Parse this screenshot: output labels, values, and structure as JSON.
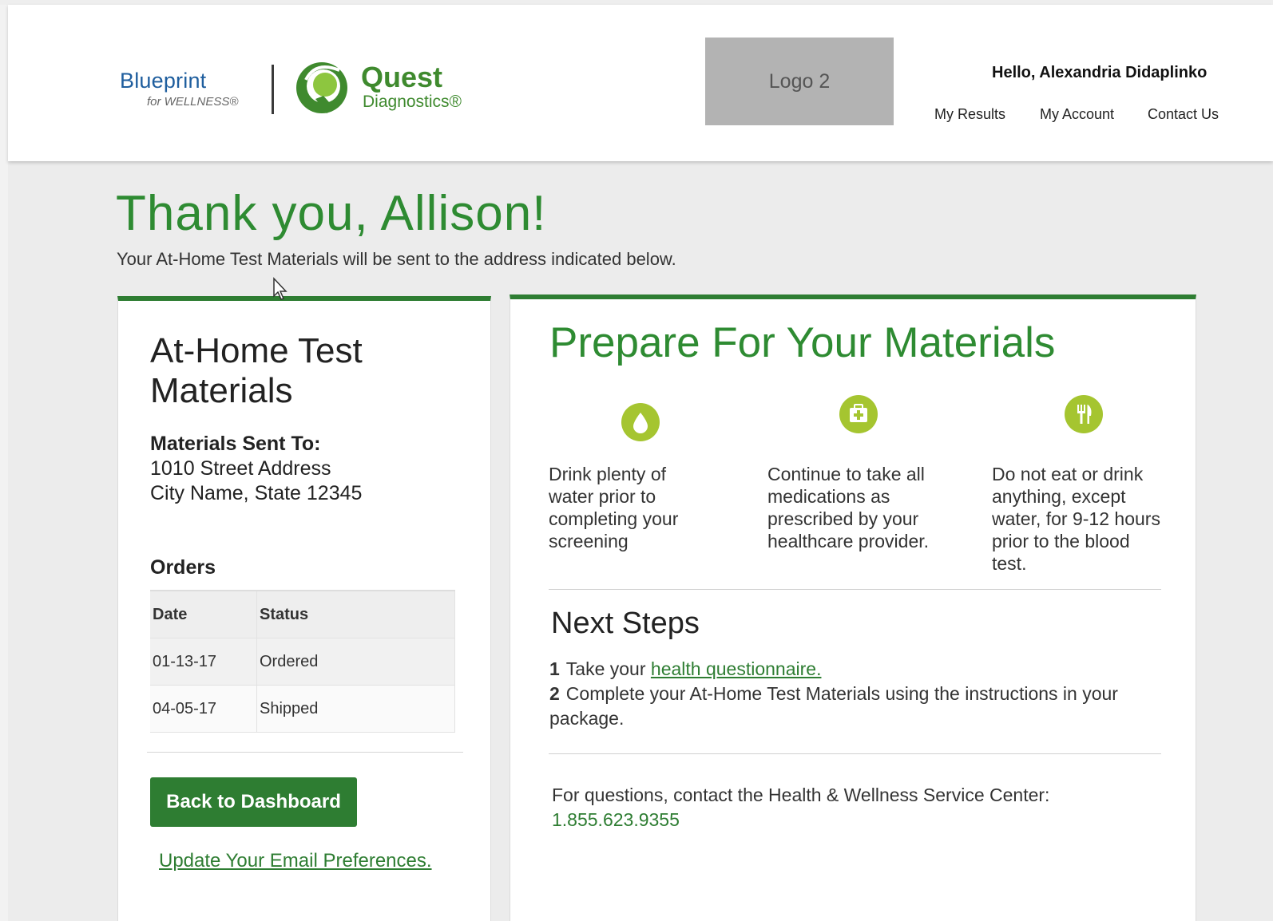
{
  "header": {
    "brand_primary": "Blueprint",
    "brand_sub": "for WELLNESS®",
    "quest_name": "Quest",
    "quest_sub": "Diagnostics®",
    "logo2_label": "Logo 2",
    "greeting": "Hello, Alexandria Didaplinko",
    "nav": [
      "My Results",
      "My Account",
      "Contact Us"
    ]
  },
  "intro": {
    "title": "Thank you, Allison!",
    "subtitle": "Your At-Home Test Materials will be sent to the address indicated below."
  },
  "left_card": {
    "title": "At-Home Test Materials",
    "sent_to_label": "Materials Sent To:",
    "address_line1": "1010 Street Address",
    "address_line2": "City Name, State 12345",
    "orders_title": "Orders",
    "orders_columns": [
      "Date",
      "Status"
    ],
    "orders": [
      {
        "date": "01-13-17",
        "status": "Ordered"
      },
      {
        "date": "04-05-17",
        "status": "Shipped"
      }
    ],
    "back_button": "Back to Dashboard",
    "email_link": "Update Your Email Preferences."
  },
  "right_card": {
    "title": "Prepare For Your Materials",
    "tips": [
      {
        "icon": "water-drop-icon",
        "text": "Drink plenty of water prior to completing your screening"
      },
      {
        "icon": "first-aid-kit-icon",
        "text": "Continue to take all medications as prescribed by your healthcare provider."
      },
      {
        "icon": "fork-knife-icon",
        "text": "Do not eat or drink anything, except water, for 9-12 hours prior to the blood test."
      }
    ],
    "next_steps_title": "Next Steps",
    "steps": [
      {
        "num": "1",
        "text_before": "Take your",
        "link": "health questionnaire."
      },
      {
        "num": "2",
        "text": "Complete your At-Home Test Materials using the instructions in your package."
      }
    ],
    "contact_text": "For questions, contact the Health & Wellness Service Center:",
    "phone": "1.855.623.9355"
  },
  "colors": {
    "brand_green": "#2e7d32",
    "title_green": "#2e8b32",
    "icon_green": "#a5c530",
    "blueprint_blue": "#1f5e9e"
  }
}
